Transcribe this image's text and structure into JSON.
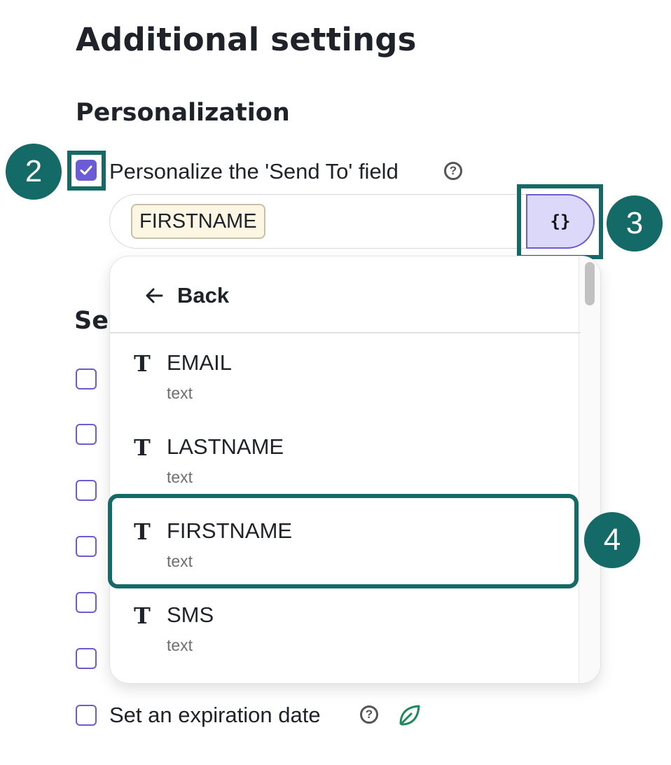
{
  "page": {
    "title": "Additional settings",
    "section_personalization": "Personalization",
    "section_partial": "Se"
  },
  "personalize": {
    "checkbox_label": "Personalize the 'Send To' field",
    "checked": true,
    "help_glyph": "?",
    "chip_value": "FIRSTNAME",
    "var_button_label": "{}"
  },
  "dropdown": {
    "back_label": "Back",
    "type_glyph": "T",
    "options": [
      {
        "name": "EMAIL",
        "type": "text"
      },
      {
        "name": "LASTNAME",
        "type": "text"
      },
      {
        "name": "FIRSTNAME",
        "type": "text"
      },
      {
        "name": "SMS",
        "type": "text"
      }
    ]
  },
  "expiration": {
    "label": "Set an expiration date",
    "help_glyph": "?",
    "leaf_icon": "leaf-icon"
  },
  "annotations": {
    "step_2": "2",
    "step_3": "3",
    "step_4": "4",
    "color": "#136a67"
  },
  "colors": {
    "accent": "#6b5cd6",
    "var_button_bg": "#dcd8fa",
    "chip_bg": "#fdf6e3",
    "annotation": "#136a67",
    "leaf": "#1a8a5a"
  }
}
